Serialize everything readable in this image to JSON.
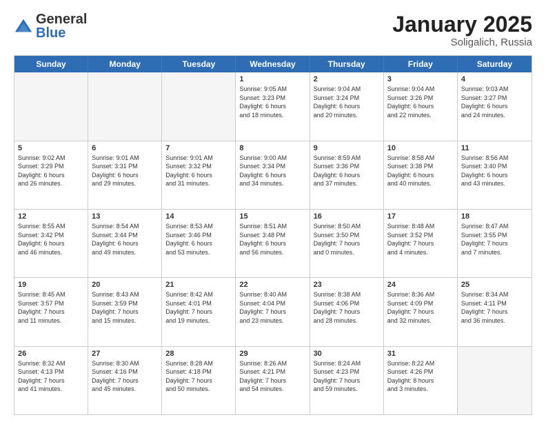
{
  "header": {
    "logo_general": "General",
    "logo_blue": "Blue",
    "month_title": "January 2025",
    "subtitle": "Soligalich, Russia"
  },
  "weekdays": [
    "Sunday",
    "Monday",
    "Tuesday",
    "Wednesday",
    "Thursday",
    "Friday",
    "Saturday"
  ],
  "rows": [
    [
      {
        "day": "",
        "empty": true,
        "lines": []
      },
      {
        "day": "",
        "empty": true,
        "lines": []
      },
      {
        "day": "",
        "empty": true,
        "lines": []
      },
      {
        "day": "1",
        "lines": [
          "Sunrise: 9:05 AM",
          "Sunset: 3:23 PM",
          "Daylight: 6 hours",
          "and 18 minutes."
        ]
      },
      {
        "day": "2",
        "lines": [
          "Sunrise: 9:04 AM",
          "Sunset: 3:24 PM",
          "Daylight: 6 hours",
          "and 20 minutes."
        ]
      },
      {
        "day": "3",
        "lines": [
          "Sunrise: 9:04 AM",
          "Sunset: 3:26 PM",
          "Daylight: 6 hours",
          "and 22 minutes."
        ]
      },
      {
        "day": "4",
        "lines": [
          "Sunrise: 9:03 AM",
          "Sunset: 3:27 PM",
          "Daylight: 6 hours",
          "and 24 minutes."
        ]
      }
    ],
    [
      {
        "day": "5",
        "lines": [
          "Sunrise: 9:02 AM",
          "Sunset: 3:29 PM",
          "Daylight: 6 hours",
          "and 26 minutes."
        ]
      },
      {
        "day": "6",
        "lines": [
          "Sunrise: 9:01 AM",
          "Sunset: 3:31 PM",
          "Daylight: 6 hours",
          "and 29 minutes."
        ]
      },
      {
        "day": "7",
        "lines": [
          "Sunrise: 9:01 AM",
          "Sunset: 3:32 PM",
          "Daylight: 6 hours",
          "and 31 minutes."
        ]
      },
      {
        "day": "8",
        "lines": [
          "Sunrise: 9:00 AM",
          "Sunset: 3:34 PM",
          "Daylight: 6 hours",
          "and 34 minutes."
        ]
      },
      {
        "day": "9",
        "lines": [
          "Sunrise: 8:59 AM",
          "Sunset: 3:36 PM",
          "Daylight: 6 hours",
          "and 37 minutes."
        ]
      },
      {
        "day": "10",
        "lines": [
          "Sunrise: 8:58 AM",
          "Sunset: 3:38 PM",
          "Daylight: 6 hours",
          "and 40 minutes."
        ]
      },
      {
        "day": "11",
        "lines": [
          "Sunrise: 8:56 AM",
          "Sunset: 3:40 PM",
          "Daylight: 6 hours",
          "and 43 minutes."
        ]
      }
    ],
    [
      {
        "day": "12",
        "lines": [
          "Sunrise: 8:55 AM",
          "Sunset: 3:42 PM",
          "Daylight: 6 hours",
          "and 46 minutes."
        ]
      },
      {
        "day": "13",
        "lines": [
          "Sunrise: 8:54 AM",
          "Sunset: 3:44 PM",
          "Daylight: 6 hours",
          "and 49 minutes."
        ]
      },
      {
        "day": "14",
        "lines": [
          "Sunrise: 8:53 AM",
          "Sunset: 3:46 PM",
          "Daylight: 6 hours",
          "and 53 minutes."
        ]
      },
      {
        "day": "15",
        "lines": [
          "Sunrise: 8:51 AM",
          "Sunset: 3:48 PM",
          "Daylight: 6 hours",
          "and 56 minutes."
        ]
      },
      {
        "day": "16",
        "lines": [
          "Sunrise: 8:50 AM",
          "Sunset: 3:50 PM",
          "Daylight: 7 hours",
          "and 0 minutes."
        ]
      },
      {
        "day": "17",
        "lines": [
          "Sunrise: 8:48 AM",
          "Sunset: 3:52 PM",
          "Daylight: 7 hours",
          "and 4 minutes."
        ]
      },
      {
        "day": "18",
        "lines": [
          "Sunrise: 8:47 AM",
          "Sunset: 3:55 PM",
          "Daylight: 7 hours",
          "and 7 minutes."
        ]
      }
    ],
    [
      {
        "day": "19",
        "lines": [
          "Sunrise: 8:45 AM",
          "Sunset: 3:57 PM",
          "Daylight: 7 hours",
          "and 11 minutes."
        ]
      },
      {
        "day": "20",
        "lines": [
          "Sunrise: 8:43 AM",
          "Sunset: 3:59 PM",
          "Daylight: 7 hours",
          "and 15 minutes."
        ]
      },
      {
        "day": "21",
        "lines": [
          "Sunrise: 8:42 AM",
          "Sunset: 4:01 PM",
          "Daylight: 7 hours",
          "and 19 minutes."
        ]
      },
      {
        "day": "22",
        "lines": [
          "Sunrise: 8:40 AM",
          "Sunset: 4:04 PM",
          "Daylight: 7 hours",
          "and 23 minutes."
        ]
      },
      {
        "day": "23",
        "lines": [
          "Sunrise: 8:38 AM",
          "Sunset: 4:06 PM",
          "Daylight: 7 hours",
          "and 28 minutes."
        ]
      },
      {
        "day": "24",
        "lines": [
          "Sunrise: 8:36 AM",
          "Sunset: 4:09 PM",
          "Daylight: 7 hours",
          "and 32 minutes."
        ]
      },
      {
        "day": "25",
        "lines": [
          "Sunrise: 8:34 AM",
          "Sunset: 4:11 PM",
          "Daylight: 7 hours",
          "and 36 minutes."
        ]
      }
    ],
    [
      {
        "day": "26",
        "lines": [
          "Sunrise: 8:32 AM",
          "Sunset: 4:13 PM",
          "Daylight: 7 hours",
          "and 41 minutes."
        ]
      },
      {
        "day": "27",
        "lines": [
          "Sunrise: 8:30 AM",
          "Sunset: 4:16 PM",
          "Daylight: 7 hours",
          "and 45 minutes."
        ]
      },
      {
        "day": "28",
        "lines": [
          "Sunrise: 8:28 AM",
          "Sunset: 4:18 PM",
          "Daylight: 7 hours",
          "and 50 minutes."
        ]
      },
      {
        "day": "29",
        "lines": [
          "Sunrise: 8:26 AM",
          "Sunset: 4:21 PM",
          "Daylight: 7 hours",
          "and 54 minutes."
        ]
      },
      {
        "day": "30",
        "lines": [
          "Sunrise: 8:24 AM",
          "Sunset: 4:23 PM",
          "Daylight: 7 hours",
          "and 59 minutes."
        ]
      },
      {
        "day": "31",
        "lines": [
          "Sunrise: 8:22 AM",
          "Sunset: 4:26 PM",
          "Daylight: 8 hours",
          "and 3 minutes."
        ]
      },
      {
        "day": "",
        "empty": true,
        "lines": []
      }
    ]
  ]
}
